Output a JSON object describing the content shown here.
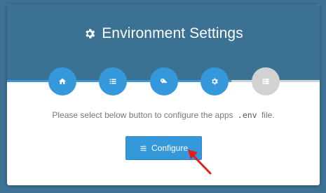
{
  "header": {
    "title": "Environment Settings",
    "title_icon": "gear-icon"
  },
  "steps": [
    {
      "icon": "home-icon",
      "state": "active"
    },
    {
      "icon": "list-icon",
      "state": "active"
    },
    {
      "icon": "key-icon",
      "state": "active"
    },
    {
      "icon": "gear-icon",
      "state": "active"
    },
    {
      "icon": "server-icon",
      "state": "inactive"
    }
  ],
  "instruction": {
    "before": "Please select below button to configure the apps",
    "code": ".env",
    "after": "file."
  },
  "configure_button": {
    "label": "Configure",
    "icon": "sliders-icon"
  },
  "colors": {
    "page_background": "#3e7396",
    "header": "#3b7192",
    "accent": "#3498db",
    "inactive_step": "#d2d2d2",
    "annotation_arrow": "#e0201c"
  }
}
